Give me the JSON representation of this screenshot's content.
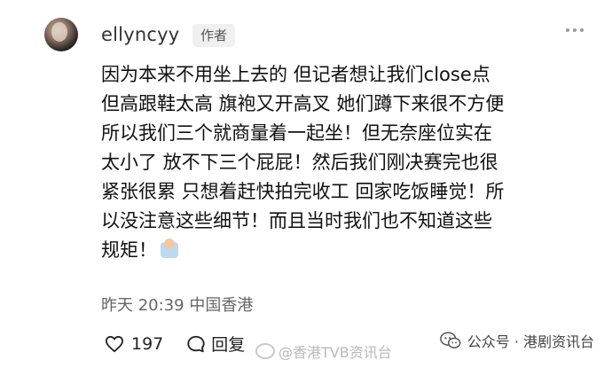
{
  "post": {
    "username": "ellyncyy",
    "author_badge": "作者",
    "lines": [
      "因为本来不用坐上去的 但记者想让我们close点",
      "但高跟鞋太高 旗袍又开高叉 她们蹲下来很不方便",
      "所以我们三个就商量着一起坐！但无奈座位实在",
      "太小了 放不下三个屁屁！然后我们刚决赛完也很",
      "紧张很累 只想着赶快拍完收工 回家吃饭睡觉！所",
      "以没注意这些细节！而且当时我们也不知道这些",
      "规矩！"
    ],
    "timestamp": "昨天 20:39 中国香港",
    "likes": "197",
    "reply_label": "回复",
    "icons": [
      "avatar",
      "more-icon",
      "emoji-icon",
      "heart-icon",
      "comment-icon",
      "wechat-icon"
    ]
  },
  "watermark": {
    "text": "@香港TVB资讯台"
  },
  "official_account": {
    "text": "公众号 · 港剧资讯台"
  }
}
